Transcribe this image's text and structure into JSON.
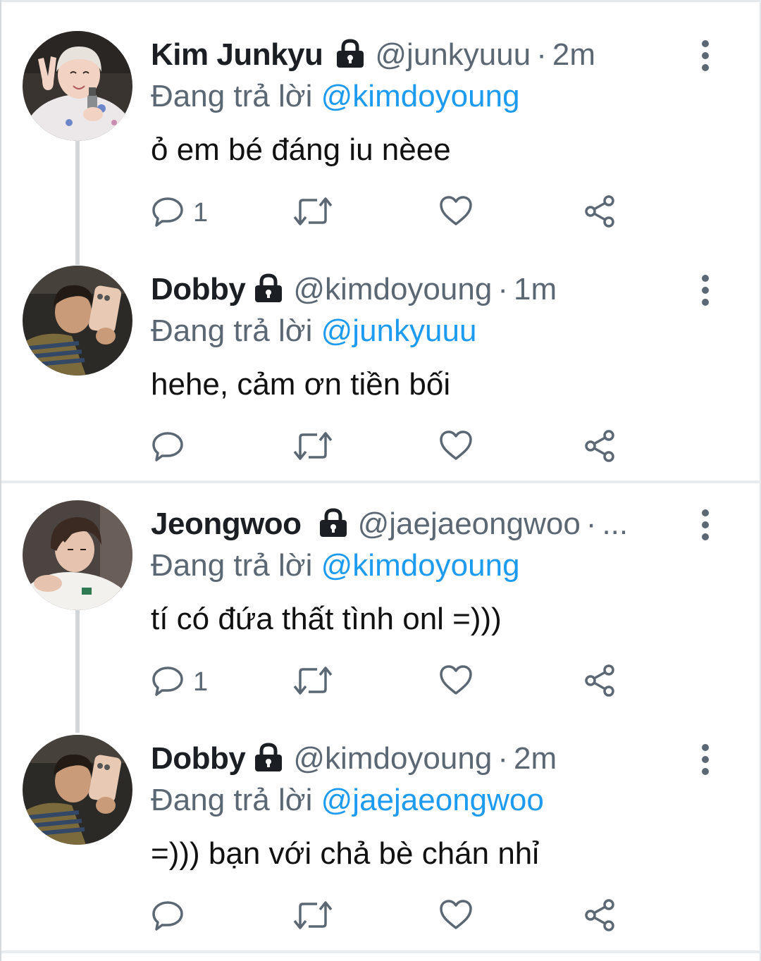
{
  "colors": {
    "accent": "#1d9bf0",
    "secondary_text": "#5b6874",
    "primary_text": "#111111",
    "divider": "#e6ecf0",
    "thread_line": "#d3d6d9"
  },
  "tweets": [
    {
      "name": "Kim Junkyu",
      "protected": true,
      "handle": "@junkyuuu",
      "separator": "·",
      "time": "2m",
      "reply_prefix": "Đang trả lời",
      "reply_to": "@kimdoyoung",
      "text": "ỏ em bé đáng iu nèee",
      "reply_count": "1",
      "icons": [
        "reply-icon",
        "retweet-icon",
        "like-icon",
        "share-icon",
        "more-icon",
        "lock-icon"
      ]
    },
    {
      "name": "Dobby",
      "protected": true,
      "handle": "@kimdoyoung",
      "separator": "·",
      "time": "1m",
      "reply_prefix": "Đang trả lời",
      "reply_to": "@junkyuuu",
      "text": "hehe, cảm ơn tiền bối",
      "reply_count": ""
    },
    {
      "name": "Jeongwoo",
      "protected": true,
      "handle": "@jaejaeongwoo",
      "separator": "·",
      "time": "...",
      "reply_prefix": "Đang trả lời",
      "reply_to": "@kimdoyoung",
      "text": "tí có đứa thất tình onl =)))",
      "reply_count": "1"
    },
    {
      "name": "Dobby",
      "protected": true,
      "handle": "@kimdoyoung",
      "separator": "·",
      "time": "2m",
      "reply_prefix": "Đang trả lời",
      "reply_to": "@jaejaeongwoo",
      "text": "=))) bạn với chả bè chán nhỉ",
      "reply_count": ""
    }
  ]
}
